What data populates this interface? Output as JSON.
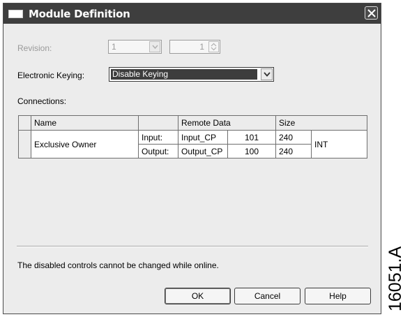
{
  "window": {
    "title": "Module Definition",
    "close_icon": "close-icon"
  },
  "revision": {
    "label": "Revision:",
    "major_value": "1",
    "minor_value": "1"
  },
  "keying": {
    "label": "Electronic Keying:",
    "value": "Disable Keying"
  },
  "connections": {
    "label": "Connections:",
    "headers": {
      "name": "Name",
      "blank": "",
      "remote": "Remote Data",
      "size": "Size"
    },
    "row": {
      "name": "Exclusive Owner",
      "input": {
        "label": "Input:",
        "remote": "Input_CP",
        "remote_num": "101",
        "size": "240"
      },
      "output": {
        "label": "Output:",
        "remote": "Output_CP",
        "remote_num": "100",
        "size": "240"
      },
      "type": "INT"
    }
  },
  "status_text": "The disabled controls cannot be changed while online.",
  "buttons": {
    "ok": "OK",
    "cancel": "Cancel",
    "help": "Help"
  },
  "figure_id": "16051.A"
}
